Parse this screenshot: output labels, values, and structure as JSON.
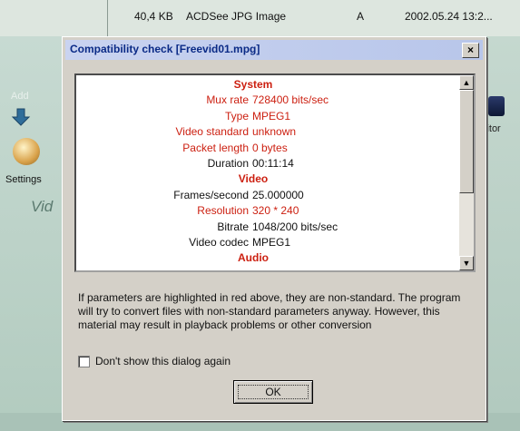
{
  "background_app": {
    "file_size": "40,4 KB",
    "file_type": "ACDSee JPG Image",
    "file_attr": "A",
    "file_date": "2002.05.24 13:2...",
    "add_label": "Add",
    "settings_label": "Settings",
    "via_label": "Vid",
    "right_label": "litor"
  },
  "dialog": {
    "title": "Compatibility check [Freevid01.mpg]",
    "close_glyph": "×",
    "rows": [
      {
        "type": "header",
        "text": "System"
      },
      {
        "type": "kv",
        "key": "Mux rate",
        "value": "728400 bits/sec",
        "red": true
      },
      {
        "type": "kv",
        "key": "Type",
        "value": "MPEG1",
        "red": true
      },
      {
        "type": "kv",
        "key": "Video standard",
        "value": "unknown",
        "red": true
      },
      {
        "type": "kv",
        "key": "Packet length",
        "value": "0 bytes",
        "red": true
      },
      {
        "type": "kv",
        "key": "Duration",
        "value": "00:11:14",
        "red": false
      },
      {
        "type": "header",
        "text": "Video"
      },
      {
        "type": "kv",
        "key": "Frames/second",
        "value": "25.000000",
        "red": false
      },
      {
        "type": "kv",
        "key": "Resolution",
        "value": "320 * 240",
        "red": true
      },
      {
        "type": "kv",
        "key": "Bitrate",
        "value": "1048/200 bits/sec",
        "red": false
      },
      {
        "type": "kv",
        "key": "Video codec",
        "value": "MPEG1",
        "red": false
      },
      {
        "type": "header",
        "text": "Audio"
      }
    ],
    "scroll_up_glyph": "▲",
    "scroll_down_glyph": "▼",
    "info_text": "If parameters are highlighted in red above, they are non-standard.  The program will try to convert files with non-standard parameters anyway. However, this material may result in playback problems or other conversion",
    "checkbox_label": "Don't show this dialog again",
    "checkbox_checked": false,
    "ok_label": "OK"
  },
  "colors": {
    "nonstandard": "#cc1f10",
    "title_text": "#0a2a86"
  }
}
